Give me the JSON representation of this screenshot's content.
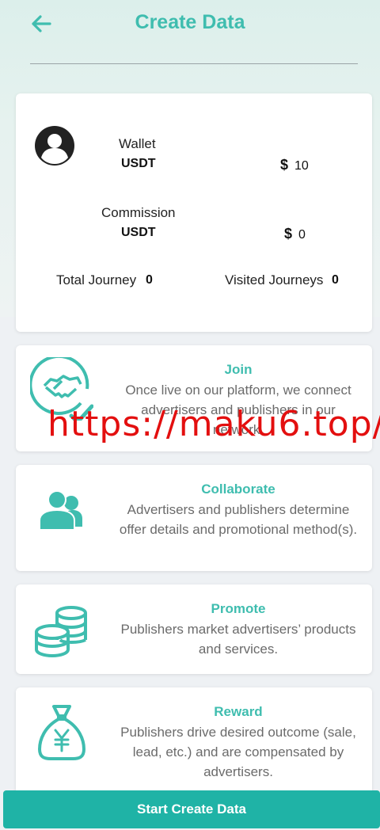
{
  "header": {
    "title": "Create Data"
  },
  "account": {
    "wallet_label": "Wallet",
    "wallet_currency": "USDT",
    "wallet_symbol": "$",
    "wallet_amount": "10",
    "commission_label": "Commission",
    "commission_currency": "USDT",
    "commission_symbol": "$",
    "commission_amount": "0",
    "total_journey_label": "Total Journey",
    "total_journey_value": "0",
    "visited_journeys_label": "Visited Journeys",
    "visited_journeys_value": "0"
  },
  "steps": [
    {
      "title": "Join",
      "desc": "Once live on our platform, we connect advertisers and publishers in our network."
    },
    {
      "title": "Collaborate",
      "desc": "Advertisers and publishers determine offer details and promotional method(s)."
    },
    {
      "title": "Promote",
      "desc": "Publishers market advertisers’ products and services."
    },
    {
      "title": "Reward",
      "desc": "Publishers drive desired outcome (sale, lead, etc.) and are compensated by advertisers."
    }
  ],
  "watermark": "https://maku6.top/",
  "footer": {
    "button_label": "Start Create Data"
  },
  "colors": {
    "accent": "#3fbdaf",
    "button": "#1fb3a6",
    "watermark": "#e30f0f"
  }
}
